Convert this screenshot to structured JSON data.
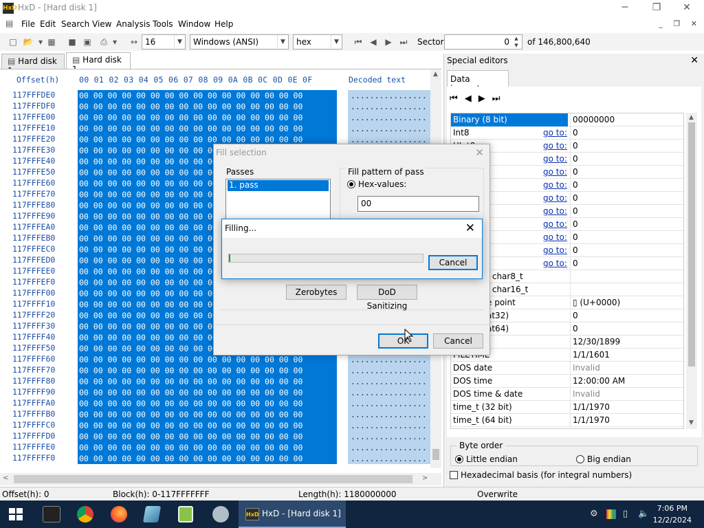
{
  "window": {
    "title": "HxD - [Hard disk 1]",
    "app_icon": "HxD"
  },
  "menu": [
    "File",
    "Edit",
    "Search",
    "View",
    "Analysis",
    "Tools",
    "Window",
    "Help"
  ],
  "toolbar": {
    "bytes_per_row": "16",
    "charset": "Windows (ANSI)",
    "offset_base": "hex",
    "sector_label": "Sector",
    "sector_value": "0",
    "sector_total": "of 146,800,640"
  },
  "tabs": [
    {
      "label": "Hard disk 1"
    },
    {
      "label": "Hard disk 1"
    }
  ],
  "editor": {
    "offset_header": "Offset(h)",
    "column_header": "00 01 02 03 04 05 06 07 08 09 0A 0B 0C 0D 0E 0F",
    "decoded_header": "Decoded text",
    "hex_row": "00 00 00 00 00 00 00 00 00 00 00 00 00 00 00 00",
    "decoded_row": "................",
    "offsets": [
      "117FFFDE0",
      "117FFFDF0",
      "117FFFE00",
      "117FFFE10",
      "117FFFE20",
      "117FFFE30",
      "117FFFE40",
      "117FFFE50",
      "117FFFE60",
      "117FFFE70",
      "117FFFE80",
      "117FFFE90",
      "117FFFEA0",
      "117FFFEB0",
      "117FFFEC0",
      "117FFFED0",
      "117FFFEE0",
      "117FFFEF0",
      "117FFFF00",
      "117FFFF10",
      "117FFFF20",
      "117FFFF30",
      "117FFFF40",
      "117FFFF50",
      "117FFFF60",
      "117FFFF70",
      "117FFFF80",
      "117FFFF90",
      "117FFFFA0",
      "117FFFFB0",
      "117FFFFC0",
      "117FFFFD0",
      "117FFFFE0",
      "117FFFFF0"
    ]
  },
  "special_editors": {
    "title": "Special editors",
    "tab": "Data inspector",
    "goto_label": "go to:",
    "rows": [
      {
        "name": "Binary (8 bit)",
        "goto": false,
        "value": "00000000",
        "selected": true
      },
      {
        "name": "Int8",
        "goto": true,
        "value": "0"
      },
      {
        "name": "UInt8",
        "goto": true,
        "value": "0"
      },
      {
        "name": "",
        "goto": true,
        "value": "0"
      },
      {
        "name": "",
        "goto": true,
        "value": "0"
      },
      {
        "name": "",
        "goto": true,
        "value": "0"
      },
      {
        "name": "",
        "goto": true,
        "value": "0"
      },
      {
        "name": "",
        "goto": true,
        "value": "0"
      },
      {
        "name": "",
        "goto": true,
        "value": "0"
      },
      {
        "name": "",
        "goto": true,
        "value": "0"
      },
      {
        "name": "",
        "goto": true,
        "value": "0"
      },
      {
        "name": "",
        "goto": true,
        "value": "0"
      },
      {
        "name": "/ char8_t",
        "goto": false,
        "value": "",
        "indent": true
      },
      {
        "name": "/ char16_t",
        "goto": false,
        "value": "",
        "indent": true
      },
      {
        "name": "e point",
        "goto": false,
        "value": "▯ (U+0000)",
        "indent": true
      },
      {
        "name": "at32)",
        "goto": false,
        "value": "0",
        "indent": true
      },
      {
        "name": "at64)",
        "goto": false,
        "value": "0",
        "indent": true
      },
      {
        "name": "OLE time",
        "goto": false,
        "value": "12/30/1899"
      },
      {
        "name": "FILETIME",
        "goto": false,
        "value": "1/1/1601"
      },
      {
        "name": "DOS date",
        "goto": false,
        "value": "Invalid",
        "invalid": true
      },
      {
        "name": "DOS time",
        "goto": false,
        "value": "12:00:00 AM"
      },
      {
        "name": "DOS time & date",
        "goto": false,
        "value": "Invalid",
        "invalid": true
      },
      {
        "name": "time_t (32 bit)",
        "goto": false,
        "value": "1/1/1970"
      },
      {
        "name": "time_t (64 bit)",
        "goto": false,
        "value": "1/1/1970"
      }
    ],
    "byte_order_label": "Byte order",
    "little_endian": "Little endian",
    "big_endian": "Big endian",
    "hex_basis": "Hexadecimal basis (for integral numbers)"
  },
  "status": {
    "offset": "Offset(h): 0",
    "block": "Block(h): 0-117FFFFFFF",
    "length": "Length(h): 1180000000",
    "mode": "Overwrite"
  },
  "fill_dialog": {
    "title": "Fill selection",
    "passes_label": "Passes",
    "pass_item": "1. pass",
    "pattern_label": "Fill pattern of pass",
    "hex_values_label": "Hex-values:",
    "hex_value": "00",
    "zerobytes": "Zerobytes",
    "dod": "DoD Sanitizing",
    "ok": "OK",
    "cancel": "Cancel"
  },
  "filling_dialog": {
    "title": "Filling...",
    "cancel": "Cancel",
    "progress": 0.005
  },
  "taskbar": {
    "active_app": "HxD - [Hard disk 1]",
    "time": "7:06 PM",
    "date": "12/2/2024"
  }
}
